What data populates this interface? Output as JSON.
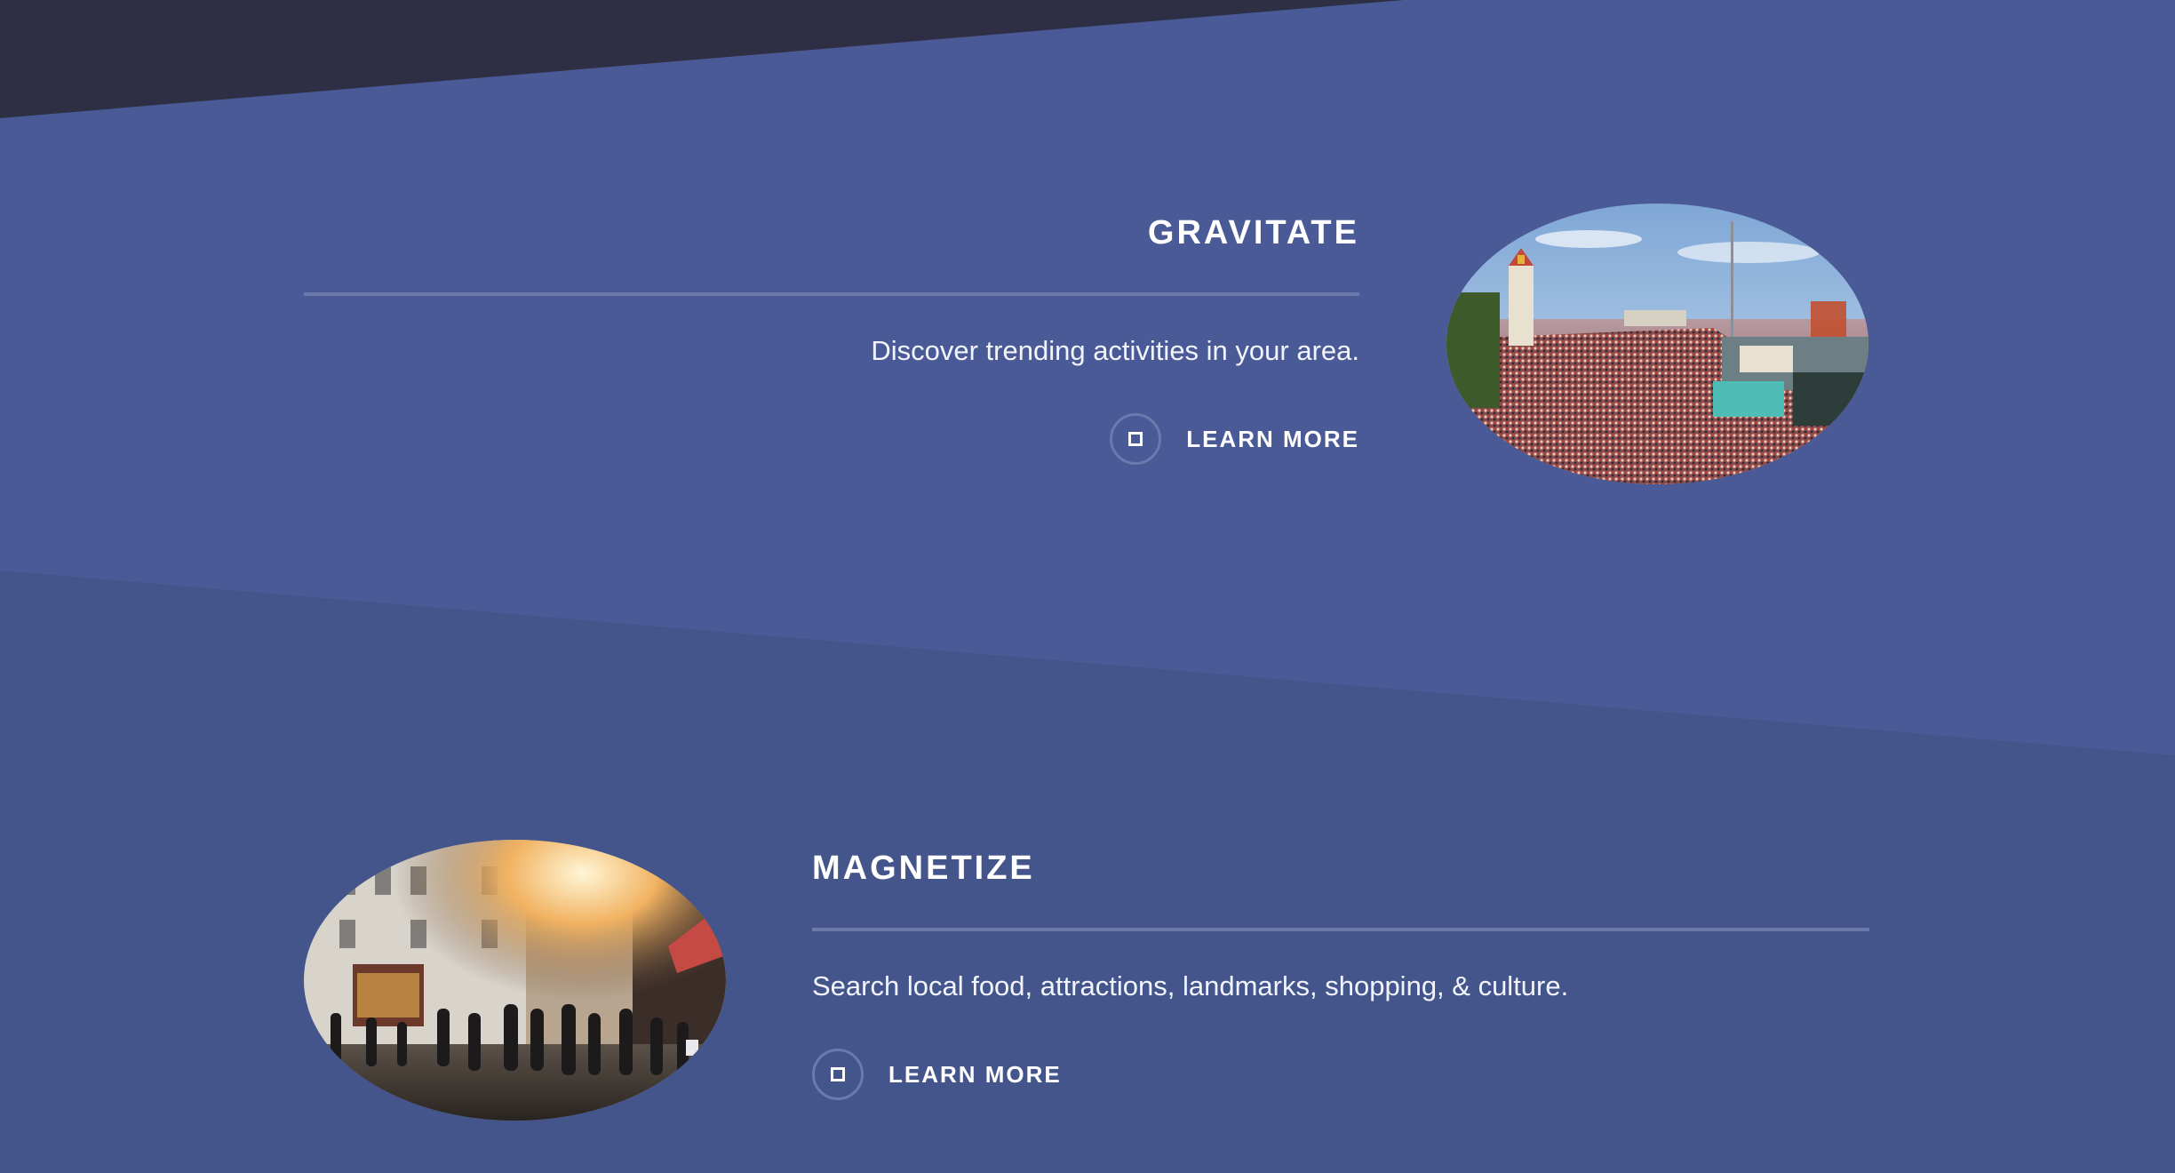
{
  "colors": {
    "dark_band": "#2e2f45",
    "section_upper": "#4a5a96",
    "section_lower": "#44558c",
    "rule": "#6a78aa",
    "text": "#ffffff"
  },
  "features": [
    {
      "title": "GRAVITATE",
      "description": "Discover trending activities in your area.",
      "cta_label": "LEARN MORE",
      "cta_icon": "square-outline-icon",
      "image": "festival-crowd-photo"
    },
    {
      "title": "MAGNETIZE",
      "description": "Search local food, attractions, landmarks, shopping, & culture.",
      "cta_label": "LEARN MORE",
      "cta_icon": "square-outline-icon",
      "image": "city-street-crowd-photo"
    }
  ]
}
